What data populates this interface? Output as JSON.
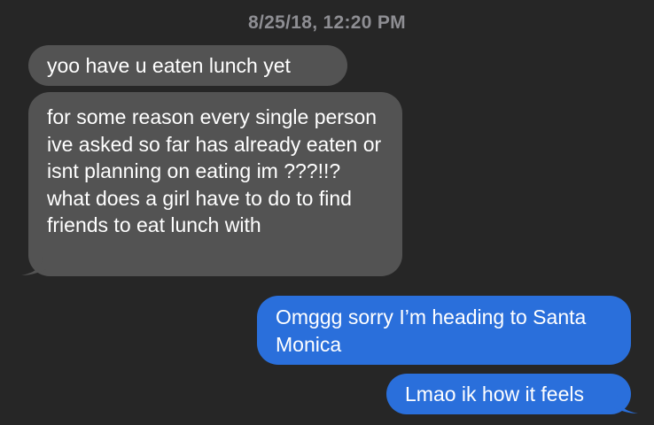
{
  "conversation": {
    "timestamp": "8/25/18, 12:20 PM",
    "messages": [
      {
        "direction": "incoming",
        "text": "yoo have u eaten lunch yet"
      },
      {
        "direction": "incoming",
        "text": "for some reason every single person ive asked so far has already eaten or isnt planning on eating im ???!!? what does a girl have to do to find friends to eat lunch with"
      },
      {
        "direction": "outgoing",
        "text": "Omggg sorry I’m heading to Santa Monica"
      },
      {
        "direction": "outgoing",
        "text": "Lmao ik how it feels"
      }
    ]
  },
  "colors": {
    "background": "#262626",
    "incoming_bubble": "#535353",
    "outgoing_bubble": "#2a6fdb",
    "timestamp_text": "#8e8e93"
  }
}
